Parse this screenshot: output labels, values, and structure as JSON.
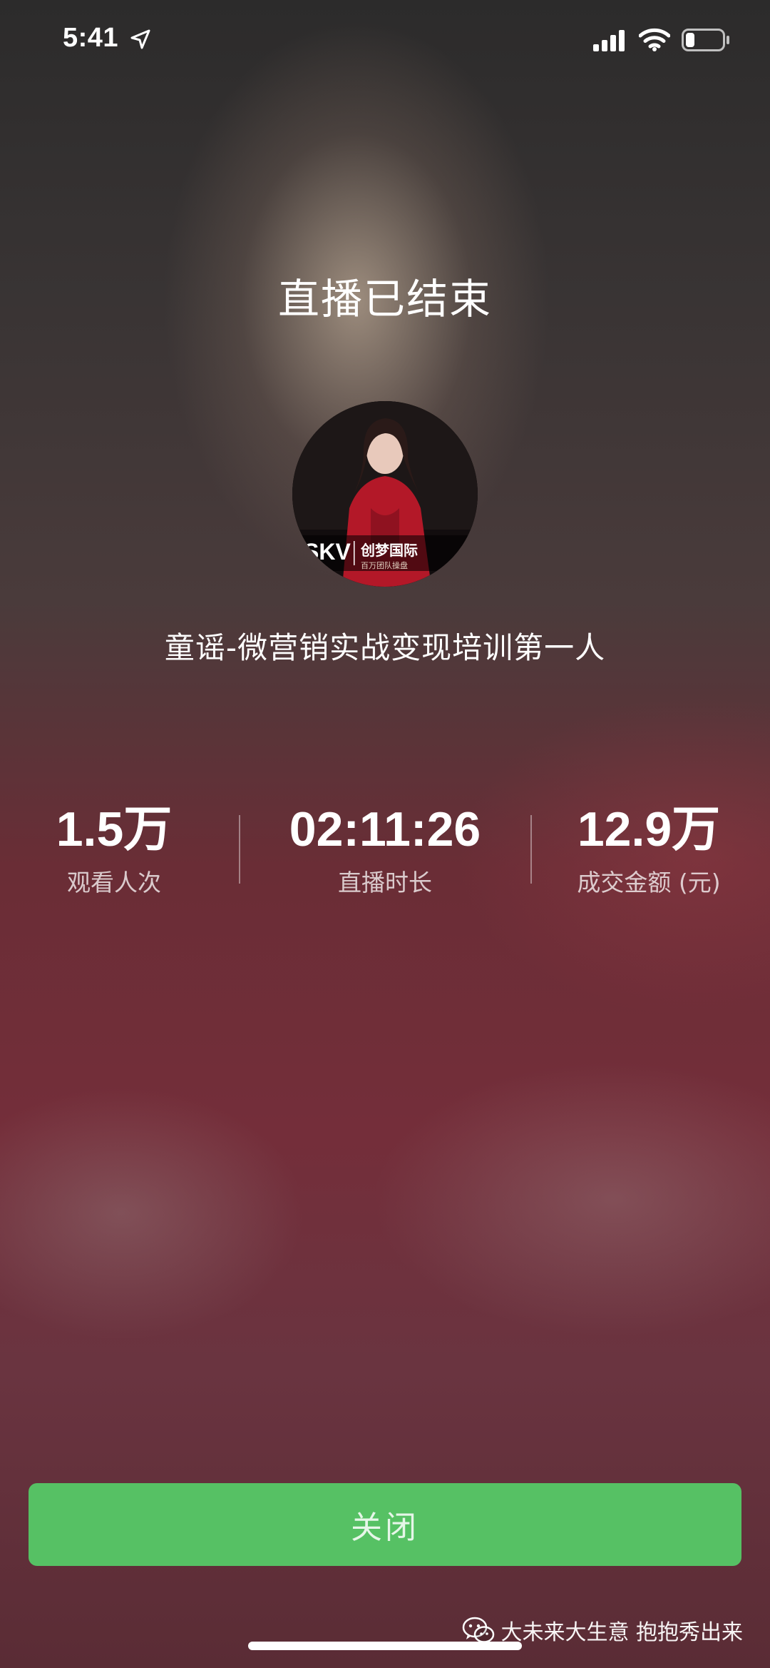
{
  "status_bar": {
    "time": "5:41",
    "icons": [
      "location-arrow-icon",
      "cellular-signal-icon",
      "wifi-icon",
      "battery-low-icon"
    ]
  },
  "live_end": {
    "title": "直播已结束",
    "avatar": {
      "logo_text": "SKV",
      "brand_text": "创梦国际",
      "slogan_text": "百万团队操盘"
    },
    "host_name": "童谣-微营销实战变现培训第一人"
  },
  "stats": [
    {
      "value": "1.5万",
      "label": "观看人次"
    },
    {
      "value": "02:11:26",
      "label": "直播时长"
    },
    {
      "value": "12.9万",
      "label": "成交金额 (元)"
    }
  ],
  "close_button": {
    "label": "关闭"
  },
  "watermark": {
    "text": "大未来大生意 抱抱秀出来",
    "icon": "wechat-icon"
  },
  "colors": {
    "button_green": "#56c164",
    "text_white": "#ffffff",
    "avatar_dress_red": "#b31828"
  }
}
